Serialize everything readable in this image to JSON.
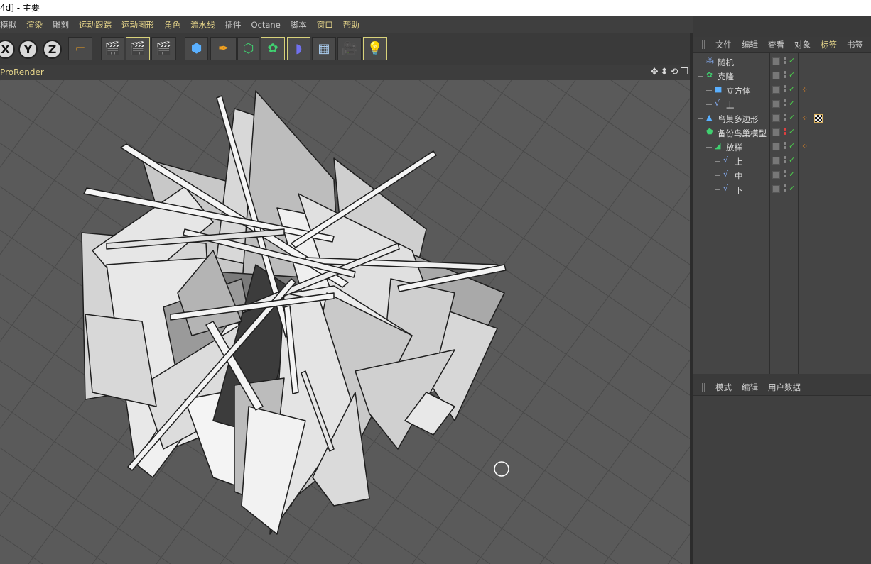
{
  "window": {
    "title": "4d] - 主要"
  },
  "menu": [
    {
      "label": "模拟",
      "dim": true
    },
    {
      "label": "渲染",
      "dim": false
    },
    {
      "label": "雕刻",
      "dim": true
    },
    {
      "label": "运动跟踪",
      "dim": false
    },
    {
      "label": "运动图形",
      "dim": false
    },
    {
      "label": "角色",
      "dim": false
    },
    {
      "label": "流水线",
      "dim": false
    },
    {
      "label": "插件",
      "dim": true
    },
    {
      "label": "Octane",
      "dim": true
    },
    {
      "label": "脚本",
      "dim": true
    },
    {
      "label": "窗口",
      "dim": false
    },
    {
      "label": "帮助",
      "dim": false
    }
  ],
  "toolbar": {
    "axes": [
      "X",
      "Y",
      "Z"
    ],
    "icons": [
      "coordinate-system-icon",
      "render-view-icon",
      "render-picture-queue-icon",
      "render-settings-icon",
      "cube-primitive-icon",
      "pen-spline-icon",
      "subdivision-icon",
      "cloner-icon",
      "deformer-icon",
      "floor-grid-icon",
      "camera-icon",
      "light-bulb-icon"
    ]
  },
  "viewport": {
    "label": "ProRender",
    "nav_icons": [
      "move-view-icon",
      "zoom-view-icon",
      "rotate-view-icon",
      "maximize-view-icon"
    ]
  },
  "object_manager": {
    "tabs": [
      {
        "label": "文件",
        "active": false
      },
      {
        "label": "编辑",
        "active": false
      },
      {
        "label": "查看",
        "active": false
      },
      {
        "label": "对象",
        "active": false
      },
      {
        "label": "标签",
        "active": true
      },
      {
        "label": "书签",
        "active": false
      }
    ],
    "objects": [
      {
        "name": "随机",
        "depth": 0,
        "icon": "random-effector-icon",
        "red_dot": false,
        "tags": []
      },
      {
        "name": "克隆",
        "depth": 0,
        "icon": "cloner-icon",
        "red_dot": false,
        "tags": []
      },
      {
        "name": "立方体",
        "depth": 1,
        "icon": "cube-icon",
        "red_dot": false,
        "tags": [
          "phong-tag-icon"
        ]
      },
      {
        "name": "上",
        "depth": 1,
        "icon": "spline-icon",
        "red_dot": false,
        "tags": []
      },
      {
        "name": "鸟巢多边形",
        "depth": 0,
        "icon": "polygon-object-icon",
        "red_dot": false,
        "tags": [
          "phong-tag-icon",
          "texture-tag-icon"
        ]
      },
      {
        "name": "备份鸟巢模型",
        "depth": 0,
        "icon": "null-object-icon",
        "red_dot": true,
        "tags": []
      },
      {
        "name": "放样",
        "depth": 1,
        "icon": "loft-icon",
        "red_dot": false,
        "tags": [
          "phong-tag-icon"
        ]
      },
      {
        "name": "上",
        "depth": 2,
        "icon": "spline-icon",
        "red_dot": false,
        "tags": []
      },
      {
        "name": "中",
        "depth": 2,
        "icon": "spline-icon",
        "red_dot": false,
        "tags": []
      },
      {
        "name": "下",
        "depth": 2,
        "icon": "spline-icon",
        "red_dot": false,
        "tags": []
      }
    ]
  },
  "attribute_manager": {
    "tabs": [
      "模式",
      "编辑",
      "用户数据"
    ]
  }
}
